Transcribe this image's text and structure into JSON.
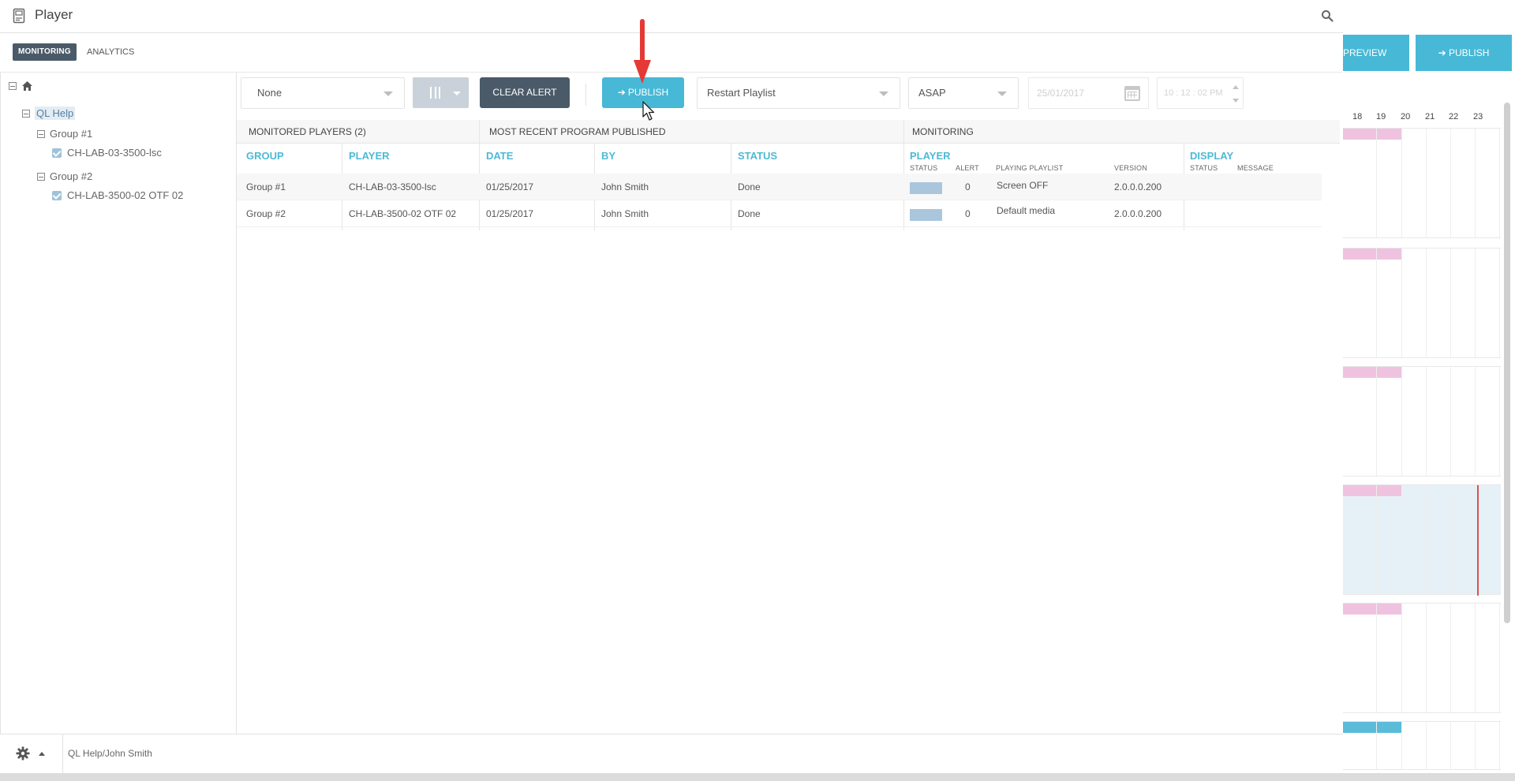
{
  "window": {
    "title": "Player"
  },
  "tabs": [
    {
      "label": "MONITORING",
      "active": true
    },
    {
      "label": "ANALYTICS",
      "active": false
    }
  ],
  "tree": {
    "root": "QL Help",
    "groups": [
      {
        "label": "Group #1",
        "players": [
          "CH-LAB-03-3500-lsc"
        ]
      },
      {
        "label": "Group #2",
        "players": [
          "CH-LAB-3500-02 OTF 02"
        ]
      }
    ]
  },
  "toolbar": {
    "filter_value": "None",
    "clear_alert_label": "CLEAR ALERT",
    "publish_label": "PUBLISH",
    "action_value": "Restart Playlist",
    "when_value": "ASAP",
    "date_placeholder": "25/01/2017",
    "time_placeholder": "10 : 12 : 02 PM"
  },
  "table": {
    "sections": {
      "monitored_players": "MONITORED PLAYERS (2)",
      "most_recent": "MOST RECENT PROGRAM PUBLISHED",
      "monitoring": "MONITORING"
    },
    "columns": {
      "group": "GROUP",
      "player": "PLAYER",
      "date": "DATE",
      "by": "BY",
      "status": "STATUS",
      "mon_player": "PLAYER",
      "display": "DISPLAY"
    },
    "subcolumns": {
      "status": "STATUS",
      "alert": "ALERT",
      "playing_playlist": "PLAYING PLAYLIST",
      "version": "VERSION",
      "display_status": "STATUS",
      "message": "MESSAGE"
    },
    "rows": [
      {
        "group": "Group #1",
        "player": "CH-LAB-03-3500-lsc",
        "date": "01/25/2017",
        "by": "John Smith",
        "status": "Done",
        "alert": "0",
        "playlist": "Screen OFF",
        "version": "2.0.0.0.200"
      },
      {
        "group": "Group #2",
        "player": "CH-LAB-3500-02 OTF 02",
        "date": "01/25/2017",
        "by": "John Smith",
        "status": "Done",
        "alert": "0",
        "playlist": "Default media",
        "version": "2.0.0.0.200"
      }
    ]
  },
  "footer": {
    "path": "QL Help/John Smith"
  },
  "right_panel": {
    "preview_label": "PREVIEW",
    "publish_label": "PUBLISH",
    "hours": [
      "18",
      "19",
      "20",
      "21",
      "22",
      "23"
    ]
  },
  "colors": {
    "accent": "#47b8d6",
    "dark_button": "#4a5a68",
    "status_player": "#aac6dd",
    "schedule_pink": "#efc3df",
    "schedule_blue": "#5bbcda",
    "annotation_red": "#e53935"
  },
  "icons": {
    "app": "player-icon",
    "search": "search-icon",
    "home": "home-icon",
    "settings": "gear-icon",
    "calendar": "calendar-icon",
    "columns": "columns-icon"
  }
}
